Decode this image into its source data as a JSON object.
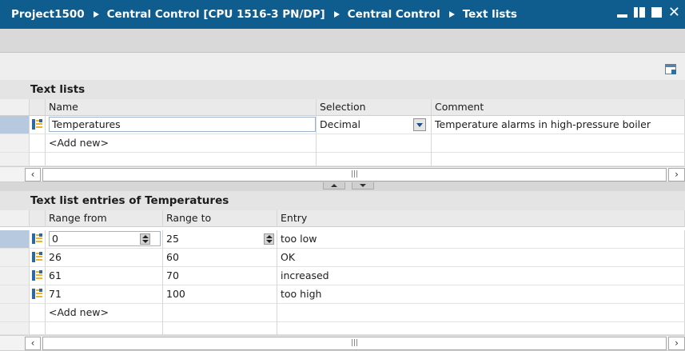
{
  "title_bar": {
    "breadcrumbs": [
      "Project1500",
      "Central Control [CPU 1516-3 PN/DP]",
      "Central Control",
      "Text lists"
    ],
    "window_controls": [
      "minimize-icon",
      "tile-icon",
      "maximize-icon",
      "close-icon"
    ],
    "close_glyph": "✕"
  },
  "toolbar": {
    "icon": "window-icon"
  },
  "text_lists": {
    "title": "Text lists",
    "columns": [
      "Name",
      "Selection",
      "Comment"
    ],
    "rows": [
      {
        "name": "Temperatures",
        "selection": "Decimal",
        "comment": "Temperature alarms in high-pressure boiler"
      }
    ],
    "add_new": "<Add new>"
  },
  "entries": {
    "title": "Text list entries of Temperatures",
    "columns": [
      "Range from",
      "Range to",
      "Entry"
    ],
    "rows": [
      {
        "from": "0",
        "to": "25",
        "entry": "too low"
      },
      {
        "from": "26",
        "to": "60",
        "entry": "OK"
      },
      {
        "from": "61",
        "to": "70",
        "entry": "increased"
      },
      {
        "from": "71",
        "to": "100",
        "entry": "too high"
      }
    ],
    "add_new": "<Add new>"
  },
  "scrollbar": {
    "left": "‹",
    "right": "›",
    "grip": "|||"
  },
  "colors": {
    "title_bar": "#0f5c8f",
    "selection": "#b7c9de",
    "icon_blue": "#2b69a6",
    "icon_yellow": "#f1b226"
  }
}
